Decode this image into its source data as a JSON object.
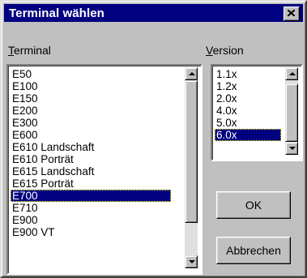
{
  "window": {
    "title": "Terminal wählen"
  },
  "terminal": {
    "label_first": "T",
    "label_rest": "erminal",
    "items": [
      "E50",
      "E100",
      "E150",
      "E200",
      "E300",
      "E600",
      "E610 Landschaft",
      "E610 Porträt",
      "E615 Landschaft",
      "E615 Porträt",
      "E700",
      "E710",
      "E900",
      "E900 VT"
    ],
    "selected": "E700"
  },
  "version": {
    "label_first": "V",
    "label_rest": "ersion",
    "items": [
      "1.1x",
      "1.2x",
      "2.0x",
      "4.0x",
      "5.0x",
      "6.0x"
    ],
    "selected": "6.0x"
  },
  "buttons": {
    "ok": "OK",
    "cancel": "Abbrechen"
  },
  "colors": {
    "title_bar": "#000080",
    "selection": "#000080",
    "face": "#c0c0c0"
  },
  "icons": {
    "close": "close-icon",
    "scroll_up": "arrow-up-icon",
    "scroll_down": "arrow-down-icon"
  }
}
